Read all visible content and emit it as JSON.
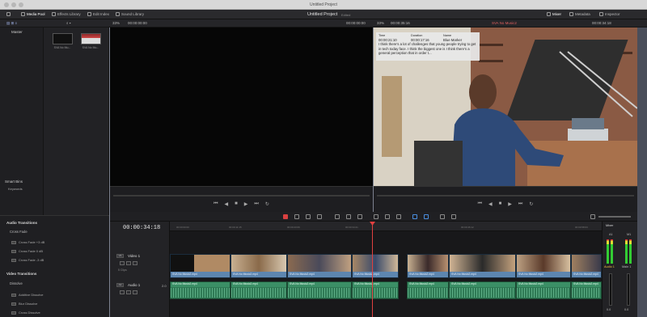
{
  "window": {
    "title": "Untitled Project"
  },
  "toolbar": {
    "media_pool": "Media Pool",
    "effects_library": "Effects Library",
    "edit_index": "Edit Index",
    "sound_library": "Sound Library",
    "project_title": "Untitled Project",
    "project_state": "Edited",
    "mixer": "Mixer",
    "metadata": "Metadata",
    "inspector": "Inspector"
  },
  "viewer_bar": {
    "source_zoom": "33%",
    "source_timecode": "00:00:00:00",
    "source_duration": "00:00:00:00",
    "timeline_zoom": "33%",
    "timeline_duration": "00:00:35:16",
    "timeline_name": "SVA No Music2",
    "timeline_timecode": "00:00:34:18"
  },
  "media_pool": {
    "bin_root": "Master",
    "smart_bins_label": "Smart Bins",
    "smart_bin_keywords": "Keywords",
    "clips": [
      {
        "name": "SVA No Mu..."
      },
      {
        "name": "SVA No Mu..."
      }
    ]
  },
  "marker_popup": {
    "col_time": "Time",
    "col_duration": "Duration",
    "col_name": "Name",
    "time": "00:00:21:10",
    "duration": "00:00:17:16",
    "name": "Blue Marker",
    "note": "I think there's a lot of challenges that young people trying to get in tech today face. I think the biggest one is I think there's a general perception that in order t..."
  },
  "effects": {
    "audio_transitions": "Audio Transitions",
    "cross_fade_group": "Cross Fade",
    "audio_items": [
      "Cross Fade +3 dB",
      "Cross Fade 0 dB",
      "Cross Fade -3 dB"
    ],
    "video_transitions": "Video Transitions",
    "dissolve_group": "Dissolve",
    "video_items": [
      "Additive Dissolve",
      "Blur Dissolve",
      "Cross Dissolve"
    ]
  },
  "timeline": {
    "timecode": "00:00:34:18",
    "ruler": [
      "00:00:00:00",
      "00:00:11:15",
      "00:00:23:06",
      "00:00:34:21",
      "00:00:46:12",
      "00:00:58:03"
    ],
    "video_track": {
      "badge": "V1",
      "name": "Video 1",
      "clip_count": "5 Clips"
    },
    "audio_track": {
      "badge": "A1",
      "name": "Audio 1",
      "level": "2.0"
    },
    "video_clips": [
      {
        "label": "SVA No Music2.mp4"
      },
      {
        "label": "SVA No Music2.mp4"
      },
      {
        "label": "SVA No Music2.mp4"
      },
      {
        "label": "SVA No Music2.mp4"
      },
      {
        "label": "SVA No Music2.mp4"
      },
      {
        "label": "SVA No Music2.mp4"
      },
      {
        "label": "SVA No Music2.mp4"
      },
      {
        "label": "SVA No Music2.mp4"
      }
    ],
    "audio_clips": [
      {
        "label": "SVA No Music2.mp4"
      },
      {
        "label": "SVA No Music2.mp4"
      },
      {
        "label": "SVA No Music2.mp4"
      },
      {
        "label": "SVA No Music2.mp4"
      },
      {
        "label": "SVA No Music2.mp4"
      },
      {
        "label": "SVA No Music2.mp4"
      },
      {
        "label": "SVA No Music2.mp4"
      },
      {
        "label": "SVA No Music2.mp4"
      }
    ]
  },
  "mixer": {
    "title": "Mixer",
    "channel_a1": "A1",
    "channel_m1": "M1",
    "strip_a1": "Audio 1",
    "strip_main": "Main 1",
    "db": "0.0"
  },
  "colors": {
    "accent_red": "#e04040",
    "video_clip": "#5d86b0",
    "audio_clip": "#3b8f66"
  }
}
